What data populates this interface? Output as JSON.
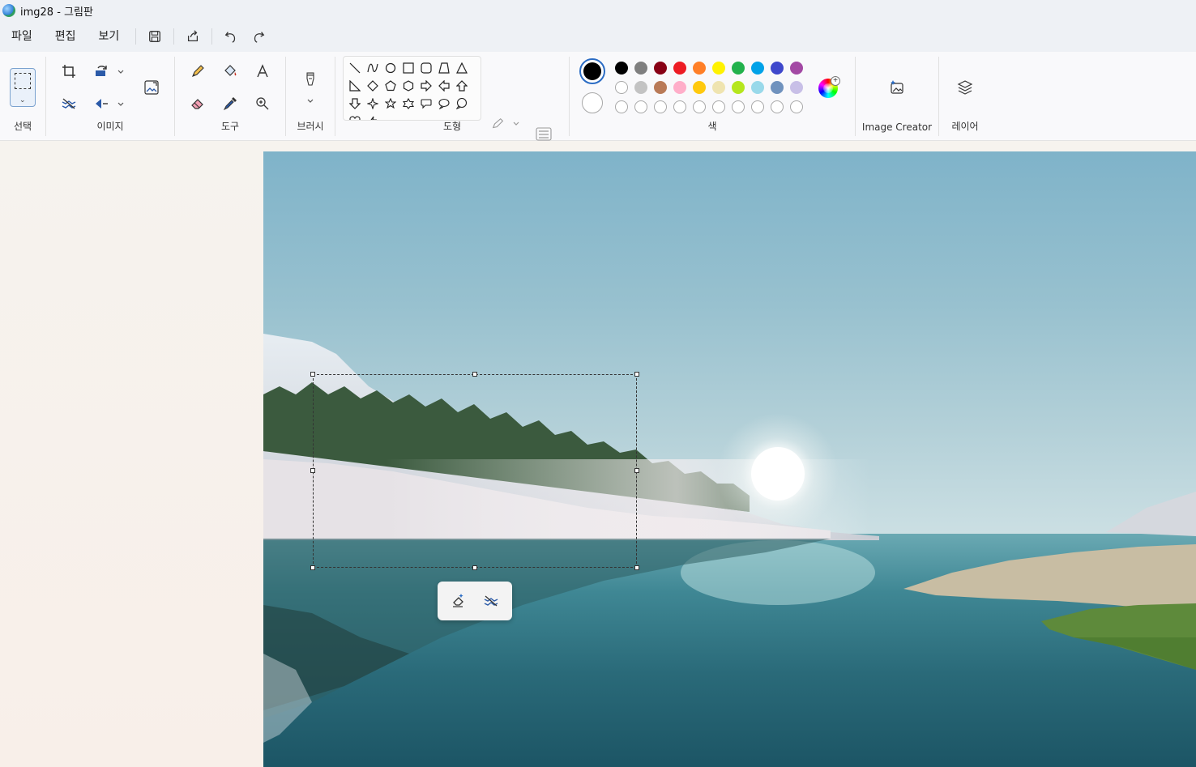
{
  "window": {
    "title": "img28 - 그림판",
    "app_icon": "paint-app-icon"
  },
  "menu": {
    "file": "파일",
    "edit": "편집",
    "view": "보기"
  },
  "quick_access": [
    "save-icon",
    "share-icon",
    "undo-icon",
    "redo-icon"
  ],
  "ribbon": {
    "select_label": "선택",
    "image_label": "이미지",
    "tools_label": "도구",
    "brush_label": "브러시",
    "shapes_label": "도형",
    "color_label": "색",
    "image_creator_label": "Image Creator",
    "layers_label": "레이어"
  },
  "colors": {
    "primary": "#000000",
    "secondary": "#ffffff",
    "palette_row1": [
      "#000000",
      "#7f7f7f",
      "#880015",
      "#ed1c24",
      "#ff7f27",
      "#fff200",
      "#22b14c",
      "#00a2e8",
      "#3f48cc",
      "#a349a4"
    ],
    "palette_row2": [
      "#ffffff",
      "#c3c3c3",
      "#b97a57",
      "#ffaec9",
      "#ffc90e",
      "#efe4b0",
      "#b5e61d",
      "#99d9ea",
      "#7092be",
      "#c8bfe7"
    ],
    "palette_row3_custom_slots": 10
  },
  "selection_toolbar": [
    "erase-selection-icon",
    "remove-background-icon"
  ]
}
